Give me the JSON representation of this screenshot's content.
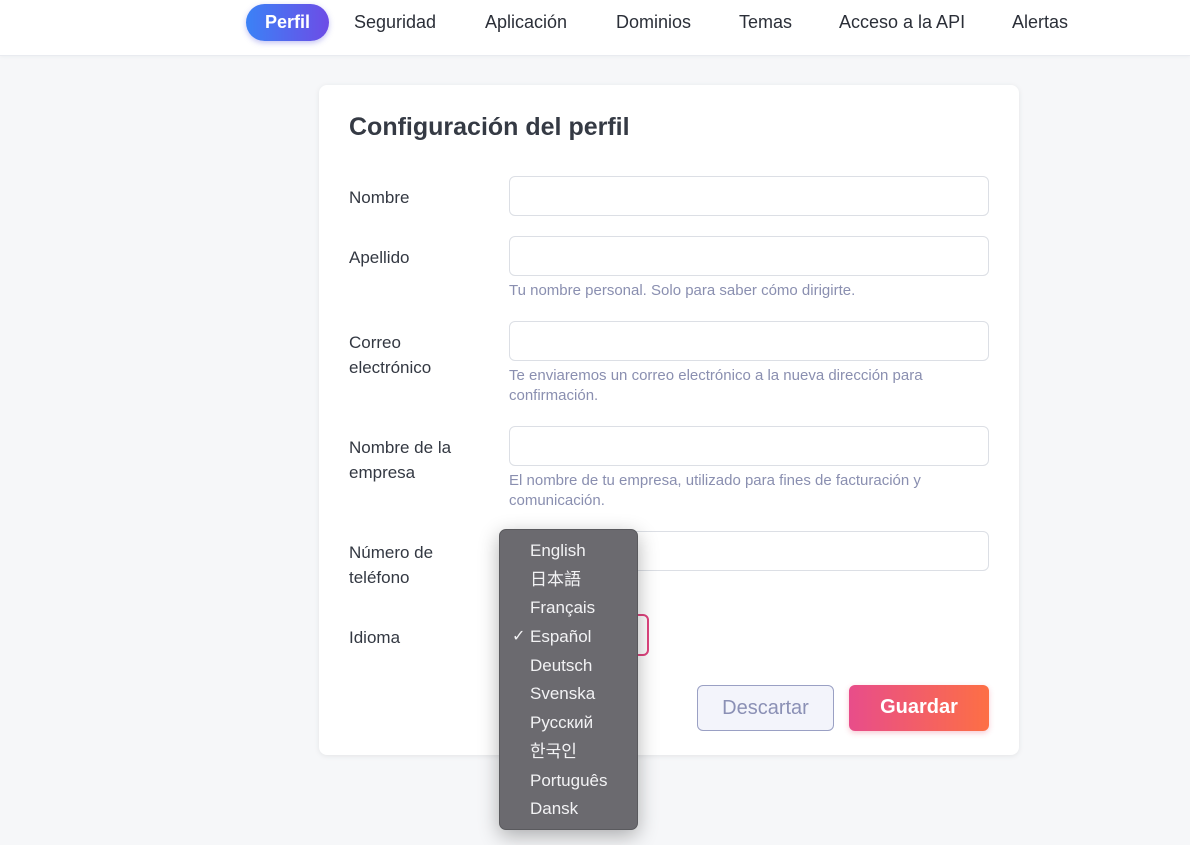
{
  "nav": {
    "tabs": [
      {
        "label": "Perfil",
        "active": true
      },
      {
        "label": "Seguridad"
      },
      {
        "label": "Aplicación"
      },
      {
        "label": "Dominios"
      },
      {
        "label": "Temas"
      },
      {
        "label": "Acceso a la API"
      },
      {
        "label": "Alertas"
      }
    ]
  },
  "form": {
    "title": "Configuración del perfil",
    "first_name": {
      "label": "Nombre",
      "value": ""
    },
    "last_name": {
      "label": "Apellido",
      "value": "",
      "help": "Tu nombre personal. Solo para saber cómo dirigirte."
    },
    "email": {
      "label": "Correo electrónico",
      "value": "",
      "help": "Te enviaremos un correo electrónico a la nueva dirección para confirmación."
    },
    "company": {
      "label": "Nombre de la empresa",
      "value": "",
      "help": "El nombre de tu empresa, utilizado para fines de facturación y comunicación."
    },
    "phone": {
      "label": "Número de teléfono",
      "value": ""
    },
    "language": {
      "label": "Idioma",
      "selected": "Español"
    },
    "discard_label": "Descartar",
    "save_label": "Guardar"
  },
  "language_menu": {
    "check_glyph": "✓",
    "options": [
      "English",
      "日本語",
      "Français",
      "Español",
      "Deutsch",
      "Svenska",
      "Русский",
      "한국인",
      "Português",
      "Dansk"
    ]
  },
  "colors": {
    "tab_active_gradient": [
      "#3b82f6",
      "#6d4ce6"
    ],
    "save_gradient": [
      "#e84d8a",
      "#fd6f45"
    ],
    "select_border": "#e0457f",
    "help_text": "#8a8fb0"
  }
}
